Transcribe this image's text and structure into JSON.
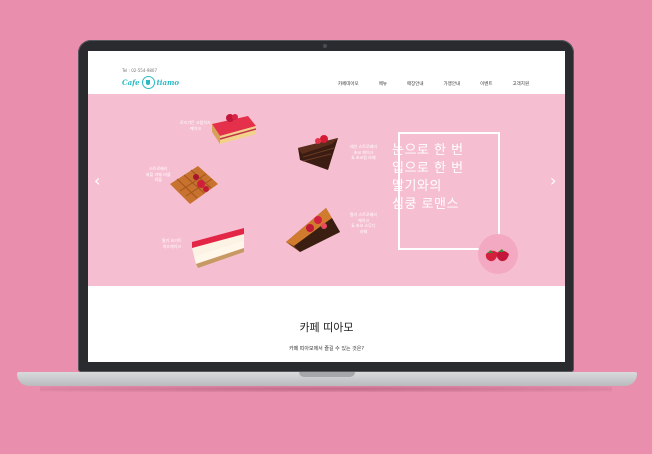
{
  "header": {
    "tel": "Tel : 02-554-9807",
    "logo_left": "Cafe",
    "logo_right": "tiamo",
    "nav": [
      "카페띠아모",
      "메뉴",
      "매장안내",
      "가맹안내",
      "이벤트",
      "고객지원"
    ]
  },
  "hero": {
    "captions": {
      "c1": "로즈가든 크림치즈\n케이크",
      "c2": "스트로베리\n와플 카페 버블\n와플",
      "c3": "딸기 요거트\n치즈케이크",
      "c4": "레인 스트로베리\n초코 케이크\n& 초코칩 라떼",
      "c5": "딸기 스트로베리\n케이크\n& 초코 스무디\n라떼"
    },
    "slogan": [
      "눈으로 한 번",
      "입으로 한 번",
      "딸기와의",
      "심쿵 로맨스"
    ],
    "prev_icon": "chevron-left-icon",
    "next_icon": "chevron-right-icon"
  },
  "section": {
    "title": "카페 띠아모",
    "subtitle": "카페 띠아모에서 즐길 수 있는 것은?"
  }
}
